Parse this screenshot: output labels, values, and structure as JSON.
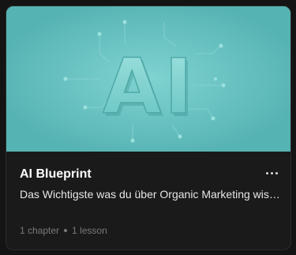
{
  "course": {
    "thumbnail_text": "AI",
    "title": "AI Blueprint",
    "description": "Das Wichtigste was du über Organic Marketing wissen musst",
    "chapters": "1 chapter",
    "lessons": "1 lesson"
  },
  "colors": {
    "thumbnail_bg": "#5fbcbc",
    "card_bg": "#1a1a1a",
    "title": "#ffffff",
    "meta": "#7a7a7a"
  },
  "icons": {
    "menu": "more-horizontal-icon"
  }
}
